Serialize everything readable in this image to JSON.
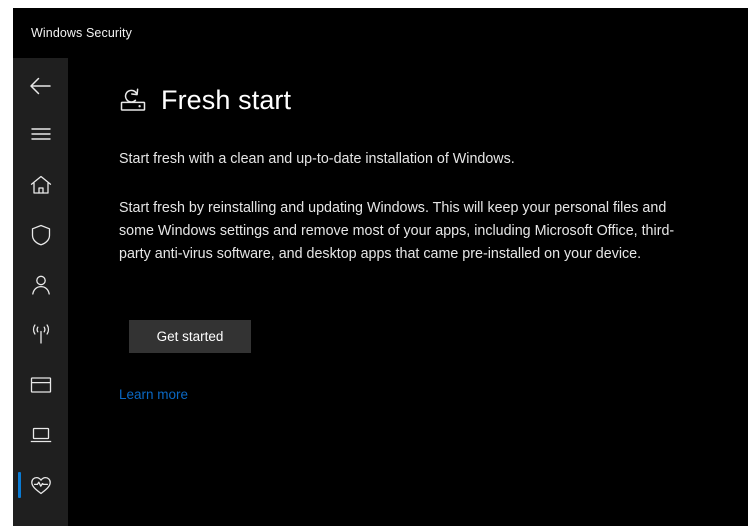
{
  "window": {
    "title": "Windows Security"
  },
  "sidebar": {
    "items": [
      {
        "name": "back-button",
        "icon": "back-arrow-icon",
        "selected": false
      },
      {
        "name": "hamburger-menu",
        "icon": "hamburger-menu-icon",
        "selected": false
      },
      {
        "name": "home",
        "icon": "home-icon",
        "selected": false
      },
      {
        "name": "virus-protection",
        "icon": "shield-icon",
        "selected": false
      },
      {
        "name": "account-protection",
        "icon": "person-icon",
        "selected": false
      },
      {
        "name": "firewall-network",
        "icon": "network-signal-icon",
        "selected": false
      },
      {
        "name": "app-browser-control",
        "icon": "window-icon",
        "selected": false
      },
      {
        "name": "device-security",
        "icon": "laptop-icon",
        "selected": false
      },
      {
        "name": "device-performance",
        "icon": "heart-pulse-icon",
        "selected": true
      }
    ]
  },
  "page": {
    "title": "Fresh start",
    "title_icon": "fresh-start-refresh-icon",
    "intro": "Start fresh with a clean and up-to-date installation of Windows.",
    "body": "Start fresh by reinstalling and updating Windows. This will keep your personal files and some Windows settings and remove most of your apps, including Microsoft Office, third-party anti-virus software, and desktop apps that came pre-installed on your device.",
    "primary_button": "Get started",
    "learn_more": "Learn more"
  },
  "colors": {
    "accent": "#0a7bd4",
    "link": "#0a68c4",
    "button_bg": "#333333",
    "sidebar_bg": "#1f1f1f",
    "content_bg": "#000000"
  }
}
